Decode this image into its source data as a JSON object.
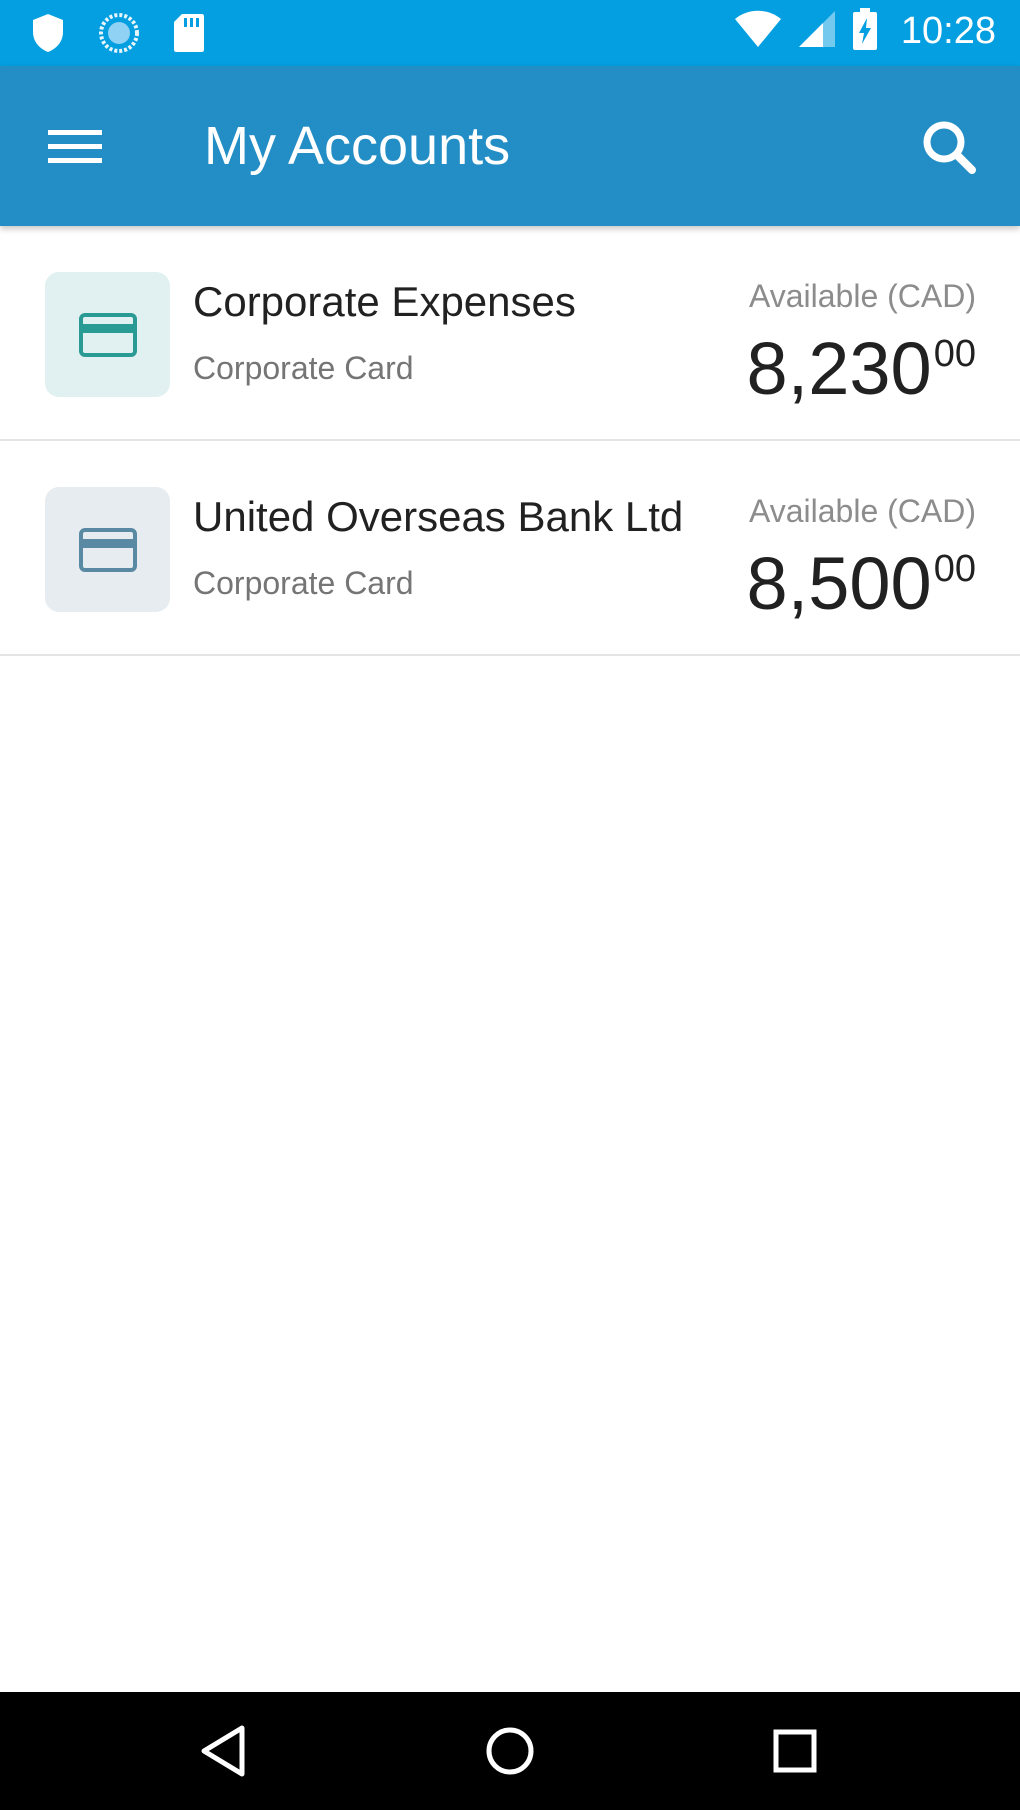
{
  "status_bar": {
    "time": "10:28",
    "left_icons": [
      "shield-icon",
      "sync-icon",
      "sd-card-icon"
    ],
    "right_icons": [
      "wifi-icon",
      "cell-signal-icon",
      "battery-charging-icon"
    ]
  },
  "app_bar": {
    "title": "My Accounts",
    "menu_icon": "hamburger-menu-icon",
    "search_icon": "search-icon"
  },
  "accounts": [
    {
      "name": "Corporate Expenses",
      "type": "Corporate Card",
      "available_label": "Available (CAD)",
      "balance_main": "8,230",
      "balance_cents": "00",
      "icon": "credit-card-icon",
      "icon_color": "#2a9a94",
      "tile_color": "#e1f0f0"
    },
    {
      "name": "United Overseas Bank Ltd",
      "type": "Corporate Card",
      "available_label": "Available (CAD)",
      "balance_main": "8,500",
      "balance_cents": "00",
      "icon": "credit-card-icon",
      "icon_color": "#5a8aa3",
      "tile_color": "#e6ecf0"
    }
  ],
  "nav_bar": {
    "back_icon": "back-triangle-icon",
    "home_icon": "home-circle-icon",
    "recents_icon": "recents-square-icon"
  },
  "colors": {
    "status_bar": "#039fe0",
    "app_bar": "#238ec5",
    "nav_bar": "#000000"
  }
}
